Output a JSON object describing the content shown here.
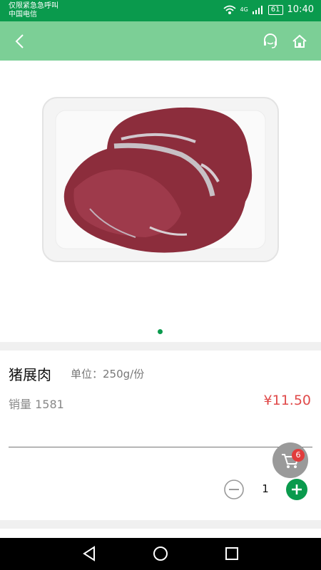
{
  "status_bar": {
    "emergency_text": "仅限紧急急呼叫",
    "carrier": "中国电信",
    "battery": "61",
    "time": "10:40",
    "network": "4G"
  },
  "header": {
    "back_icon": "chevron-left-icon",
    "service_icon": "customer-service-icon",
    "home_icon": "home-icon"
  },
  "product": {
    "name": "猪展肉",
    "unit": "单位：250g/份",
    "sales": "销量 1581",
    "price": "¥11.50",
    "quantity": "1"
  },
  "cart": {
    "count": "6"
  },
  "colors": {
    "status_bar": "#0a9a4d",
    "header": "#7ccf96",
    "accent": "#0a9a4d",
    "price": "#e04a4a"
  },
  "gallery": {
    "pages": 1,
    "current_page": 1
  }
}
